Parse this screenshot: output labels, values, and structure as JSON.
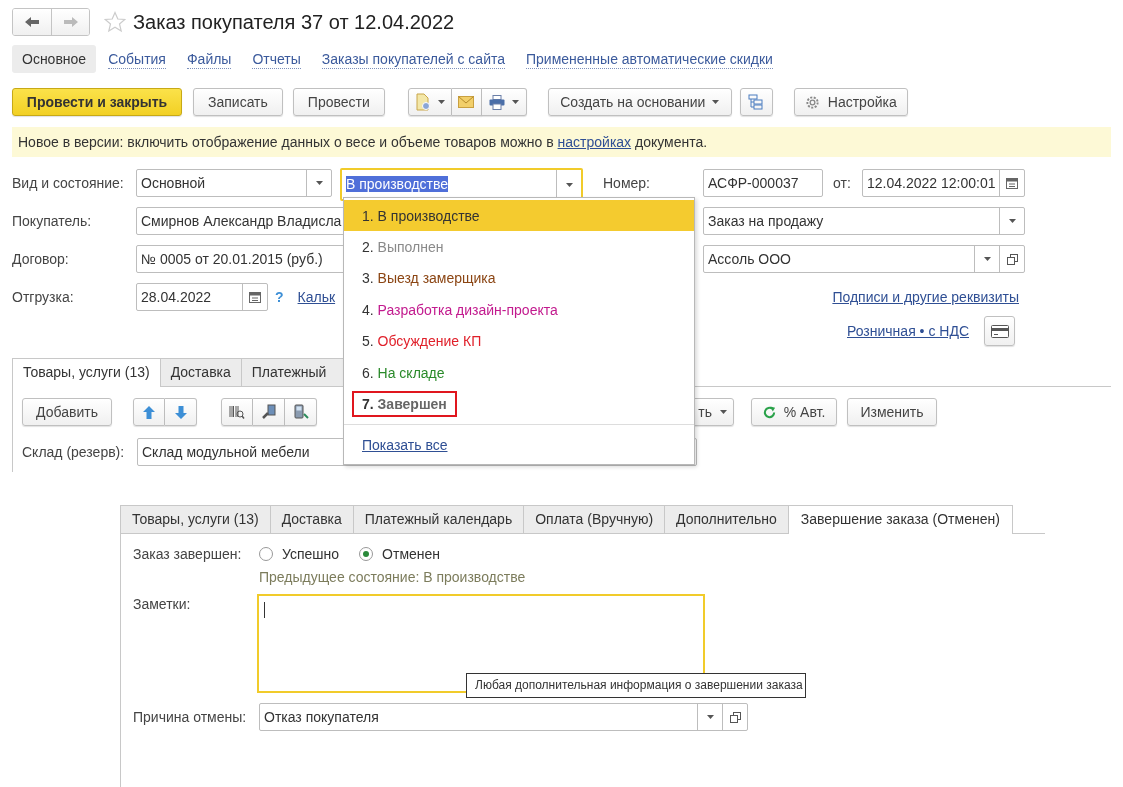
{
  "window": {
    "title": "Заказ покупателя 37 от 12.04.2022"
  },
  "nav_tabs": [
    {
      "label": "Основное",
      "selected": true
    },
    {
      "label": "События",
      "selected": false
    },
    {
      "label": "Файлы",
      "selected": false
    },
    {
      "label": "Отчеты",
      "selected": false
    },
    {
      "label": "Заказы покупателей с сайта",
      "selected": false
    },
    {
      "label": "Примененные автоматические скидки",
      "selected": false
    }
  ],
  "toolbar": {
    "post_close": "Провести и закрыть",
    "save": "Записать",
    "post": "Провести",
    "create_based": "Создать на основании",
    "settings": "Настройка"
  },
  "info_bar": {
    "before": "Новое в версии: включить отображение данных о весе и объеме товаров можно в",
    "link": "настройках",
    "after": "документа."
  },
  "form": {
    "kind_label": "Вид и состояние:",
    "kind_value": "Основной",
    "status_value": "В производстве",
    "number_label": "Номер:",
    "number": "АСФР-000037",
    "date_label": "от:",
    "date": "12.04.2022 12:00:01",
    "customer_label": "Покупатель:",
    "customer": "Смирнов Александр Владисла",
    "operation": "Заказ на продажу",
    "contract_label": "Договор:",
    "contract": "№ 0005 от 20.01.2015 (руб.)",
    "organization": "Ассоль ООО",
    "shipment_label": "Отгрузка:",
    "shipment_date": "28.04.2022",
    "help": "?",
    "calc_link": "Кальк",
    "signatures_link": "Подписи и другие реквизиты",
    "price_link": "Розничная • с НДС"
  },
  "status_dropdown": {
    "items": [
      {
        "number": "1.",
        "label": "В производстве",
        "color": "#333333",
        "selected": true,
        "bold": false,
        "marked": false
      },
      {
        "number": "2.",
        "label": "Выполнен",
        "color": "#8a8a8a",
        "selected": false,
        "bold": false,
        "marked": false
      },
      {
        "number": "3.",
        "label": "Выезд замерщика",
        "color": "#8b4513",
        "selected": false,
        "bold": false,
        "marked": false
      },
      {
        "number": "4.",
        "label": "Разработка дизайн-проекта",
        "color": "#c21a8e",
        "selected": false,
        "bold": false,
        "marked": false
      },
      {
        "number": "5.",
        "label": "Обсуждение КП",
        "color": "#e0202a",
        "selected": false,
        "bold": false,
        "marked": false
      },
      {
        "number": "6.",
        "label": "На складе",
        "color": "#2a8a2a",
        "selected": false,
        "bold": false,
        "marked": false
      },
      {
        "number": "7.",
        "label": "Завершен",
        "color": "#666666",
        "selected": false,
        "bold": true,
        "marked": true
      }
    ],
    "show_all": "Показать все"
  },
  "goods_tabs": [
    {
      "label": "Товары, услуги (13)",
      "selected": true
    },
    {
      "label": "Доставка",
      "selected": false
    },
    {
      "label": "Платежный",
      "selected": false
    }
  ],
  "goods_toolbar": {
    "add": "Добавить",
    "cut_button": "ть",
    "auto_discount": "% Авт.",
    "change": "Изменить"
  },
  "warehouse": {
    "label": "Склад (резерв):",
    "value": "Склад модульной мебели"
  },
  "lower_tabs": [
    {
      "label": "Товары, услуги (13)",
      "selected": false
    },
    {
      "label": "Доставка",
      "selected": false
    },
    {
      "label": "Платежный календарь",
      "selected": false
    },
    {
      "label": "Оплата (Вручную)",
      "selected": false
    },
    {
      "label": "Дополнительно",
      "selected": false
    },
    {
      "label": "Завершение заказа (Отменен)",
      "selected": true
    }
  ],
  "completion": {
    "label": "Заказ завершен:",
    "options": [
      {
        "label": "Успешно",
        "selected": false
      },
      {
        "label": "Отменен",
        "selected": true
      }
    ],
    "previous_state": "Предыдущее состояние: В производстве",
    "notes_label": "Заметки:",
    "notes_tooltip": "Любая дополнительная информация о завершении заказа",
    "cancel_reason_label": "Причина отмены:",
    "cancel_reason": "Отказ покупателя"
  }
}
